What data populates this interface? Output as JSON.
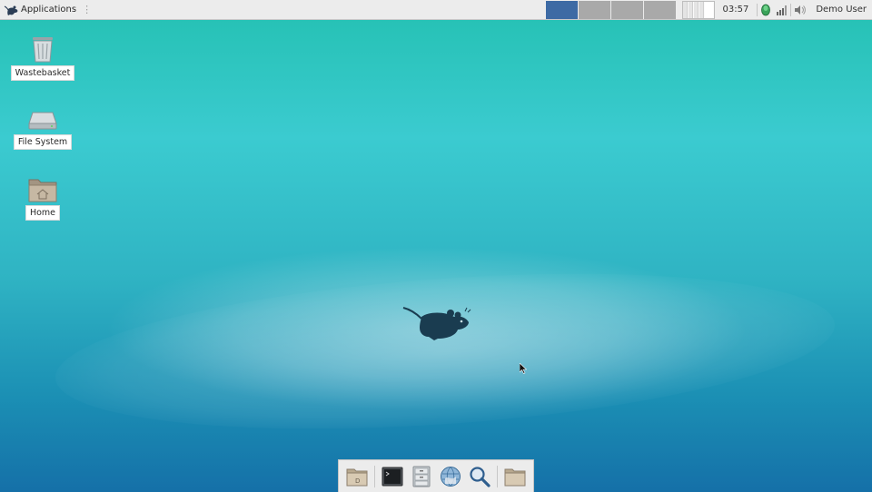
{
  "panel": {
    "applications_label": "Applications",
    "workspaces": [
      {
        "name": "Workspace 1",
        "active": true
      },
      {
        "name": "Workspace 2",
        "active": false
      },
      {
        "name": "Workspace 3",
        "active": false
      },
      {
        "name": "Workspace 4",
        "active": false
      }
    ],
    "clock": "03:57",
    "user_label": "Demo User",
    "tray_icons": [
      "network-shield-icon",
      "signal-bars-icon",
      "volume-icon"
    ],
    "accent_color": "#3d6aa4"
  },
  "desktop": {
    "icons": [
      {
        "label": "Wastebasket",
        "icon": "trash-icon"
      },
      {
        "label": "File System",
        "icon": "drive-icon"
      },
      {
        "label": "Home",
        "icon": "home-folder-icon"
      }
    ],
    "wallpaper_logo": "xfce-mouse-logo"
  },
  "dock": {
    "items": [
      "show-desktop-icon",
      "terminal-icon",
      "file-manager-icon",
      "web-browser-icon",
      "app-finder-icon",
      "folder-icon"
    ]
  }
}
